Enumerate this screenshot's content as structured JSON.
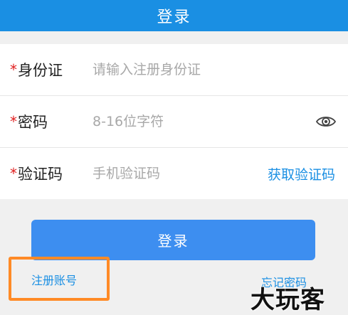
{
  "header": {
    "title": "登录"
  },
  "form": {
    "id_card": {
      "required_mark": "*",
      "label": "身份证",
      "placeholder": "请输入注册身份证"
    },
    "password": {
      "required_mark": "*",
      "label": "密码",
      "placeholder": "8-16位字符",
      "toggle_icon": "eye-icon"
    },
    "verify_code": {
      "required_mark": "*",
      "label": "验证码",
      "placeholder": "手机验证码",
      "get_code_label": "获取验证码"
    }
  },
  "actions": {
    "login_label": "登录",
    "register_label": "注册账号",
    "forgot_label": "忘记密码"
  },
  "watermark": {
    "text": "大玩客"
  },
  "colors": {
    "primary": "#1a8fe3",
    "button": "#3d8ef0",
    "required": "#e02020",
    "highlight": "#ff8a26"
  }
}
